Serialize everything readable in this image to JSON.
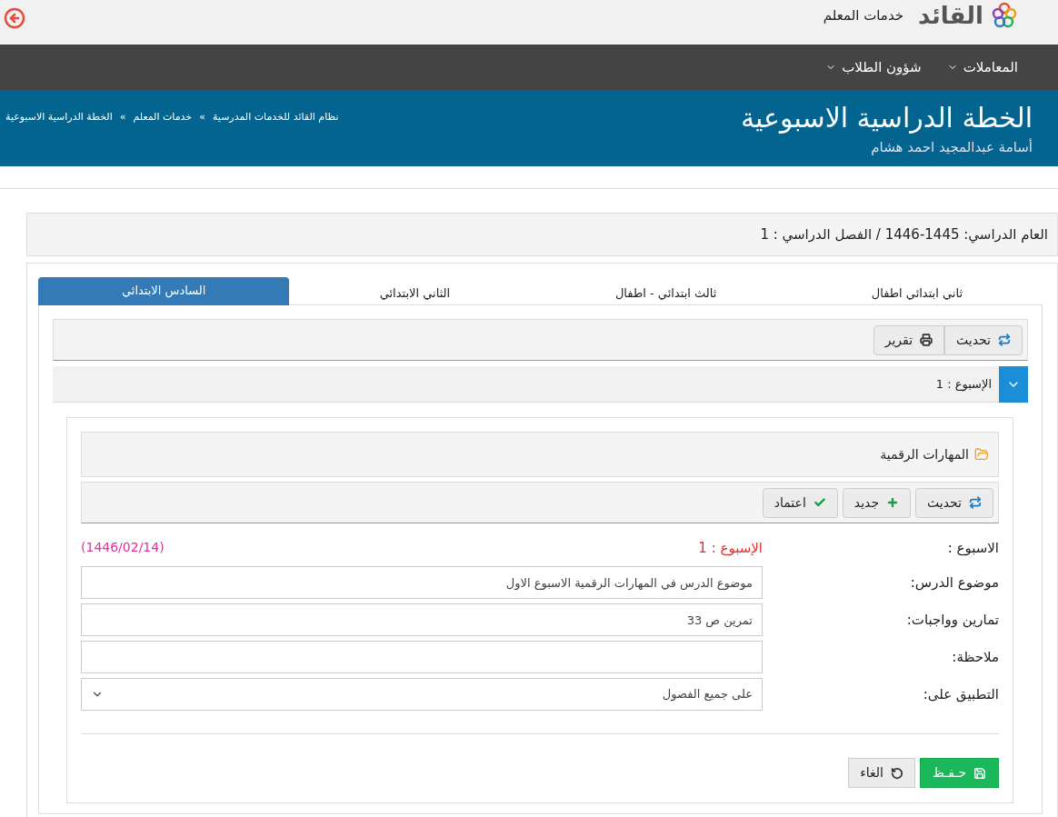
{
  "header": {
    "logo_text": "القائد",
    "subtitle": "خدمات المعلم"
  },
  "nav": [
    {
      "label": "المعاملات",
      "has_menu": true
    },
    {
      "label": "شؤون الطلاب",
      "has_menu": true
    }
  ],
  "banner": {
    "title": "الخطة الدراسية الاسبوعية",
    "user": "أسامة عبدالمجيد احمد هشام",
    "breadcrumbs": [
      "نظام القائد للخدمات المدرسية",
      "خدمات المعلم",
      "الخطة الدراسية الاسبوعية"
    ],
    "separator": "»"
  },
  "year_bar": "العام الدراسي: 1445-1446 / الفصل الدراسي : 1",
  "tabs": [
    {
      "label": "ثاني ابتدائي اطفال",
      "selected": false
    },
    {
      "label": "ثالث ابتدائي - اطفال",
      "selected": false
    },
    {
      "label": "الثاني الابتدائي",
      "selected": false
    },
    {
      "label": "السادس الابتدائي",
      "selected": true
    }
  ],
  "toolbar": [
    {
      "label": "تحديث",
      "kind": "refresh"
    },
    {
      "label": "تقرير",
      "kind": "print"
    }
  ],
  "week_panel": {
    "label": "الإسبوع : 1",
    "expanded": true
  },
  "section": {
    "title": "المهارات الرقمية",
    "buttons": [
      {
        "label": "تحديث",
        "kind": "refresh"
      },
      {
        "label": "جديد",
        "kind": "new"
      },
      {
        "label": "اعتماد",
        "kind": "approve"
      }
    ]
  },
  "form": {
    "week_label": "الاسبوع :",
    "week_value": "الإسبوع : 1",
    "week_date": "(1446/02/14)",
    "fields": [
      {
        "label": "موضوع الدرس:",
        "value": "موضوع الدرس في المهارات الرقمية الاسبوع الاول",
        "kind": "text"
      },
      {
        "label": "تمارين وواجبات:",
        "value": "تمرين ص 33",
        "kind": "text"
      },
      {
        "label": "ملاحظة:",
        "kind": "text"
      },
      {
        "label": "التطبيق على:",
        "value": "على جميع الفصول",
        "kind": "select"
      }
    ]
  },
  "actions": [
    {
      "label": "حـفـظ",
      "kind": "save"
    },
    {
      "label": "الغاء",
      "kind": "cancel"
    }
  ]
}
